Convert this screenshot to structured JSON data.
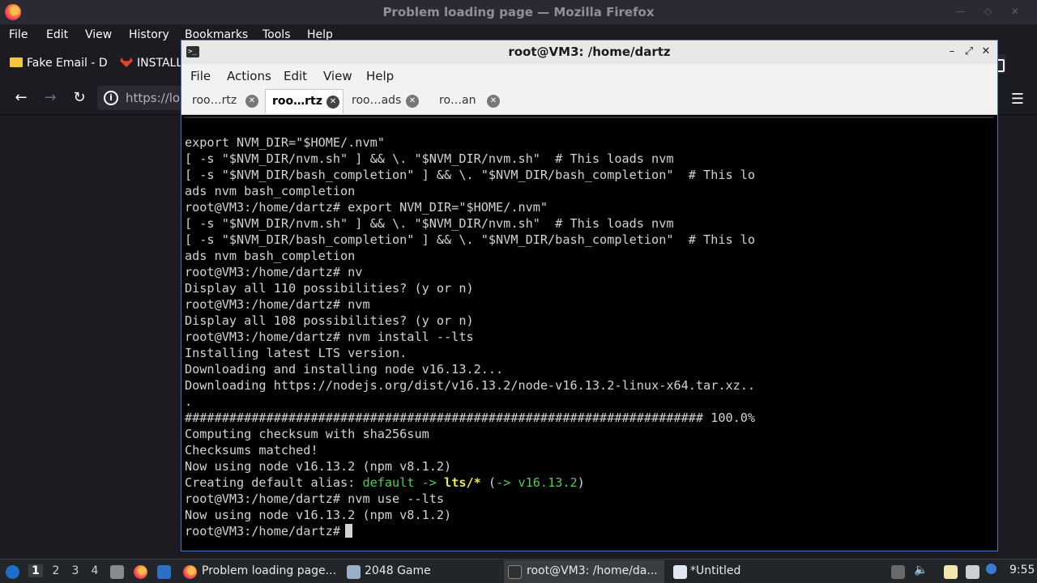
{
  "firefox": {
    "window_title": "Problem loading page — Mozilla Firefox",
    "menu": [
      "File",
      "Edit",
      "View",
      "History",
      "Bookmarks",
      "Tools",
      "Help"
    ],
    "bookmarks": [
      "Fake Email - D",
      "INSTALL"
    ],
    "url_partial": "https://loc"
  },
  "terminal": {
    "title": "root@VM3: /home/dartz",
    "menu": [
      "File",
      "Actions",
      "Edit",
      "View",
      "Help"
    ],
    "tabs": [
      {
        "label": "roo…rtz",
        "active": false
      },
      {
        "label": "roo…rtz",
        "active": true
      },
      {
        "label": "roo…ads",
        "active": false
      },
      {
        "label": "ro…an",
        "active": false
      }
    ],
    "lines": [
      "export NVM_DIR=\"$HOME/.nvm\"",
      "[ -s \"$NVM_DIR/nvm.sh\" ] && \\. \"$NVM_DIR/nvm.sh\"  # This loads nvm",
      "[ -s \"$NVM_DIR/bash_completion\" ] && \\. \"$NVM_DIR/bash_completion\"  # This lo",
      "ads nvm bash_completion",
      "root@VM3:/home/dartz# export NVM_DIR=\"$HOME/.nvm\"",
      "[ -s \"$NVM_DIR/nvm.sh\" ] && \\. \"$NVM_DIR/nvm.sh\"  # This loads nvm",
      "[ -s \"$NVM_DIR/bash_completion\" ] && \\. \"$NVM_DIR/bash_completion\"  # This lo",
      "ads nvm bash_completion",
      "root@VM3:/home/dartz# nv",
      "Display all 110 possibilities? (y or n)",
      "root@VM3:/home/dartz# nvm",
      "Display all 108 possibilities? (y or n)",
      "root@VM3:/home/dartz# nvm install --lts",
      "Installing latest LTS version.",
      "Downloading and installing node v16.13.2...",
      "Downloading https://nodejs.org/dist/v16.13.2/node-v16.13.2-linux-x64.tar.xz..",
      ".",
      "###################################################################### 100.0%",
      "Computing checksum with sha256sum",
      "Checksums matched!",
      "Now using node v16.13.2 (npm v8.1.2)"
    ],
    "alias_line": {
      "prefix": "Creating default alias: ",
      "alias": "default",
      "arrow": " -> ",
      "target": "lts/*",
      "paren_open": " (",
      "arrow2": "-> ",
      "version": "v16.13.2",
      "paren_close": ")"
    },
    "after_lines": [
      "root@VM3:/home/dartz# nvm use --lts",
      "Now using node v16.13.2 (npm v8.1.2)"
    ],
    "prompt": "root@VM3:/home/dartz#"
  },
  "taskbar": {
    "workspaces": [
      "1",
      "2",
      "3",
      "4"
    ],
    "tasks": [
      "Problem loading page...",
      "2048 Game",
      "root@VM3: /home/da...",
      "*Untitled"
    ],
    "clock": "9:55"
  }
}
